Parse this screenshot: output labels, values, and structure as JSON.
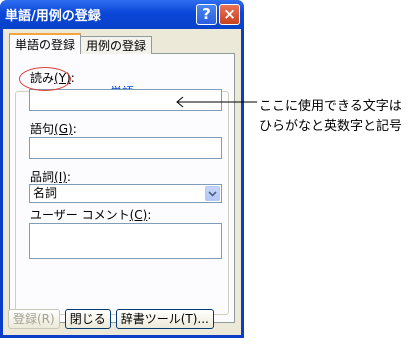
{
  "window": {
    "title": "単語/用例の登録",
    "help_glyph": "?",
    "close_glyph": "×"
  },
  "tabs": [
    {
      "label": "単語の登録",
      "active": true
    },
    {
      "label": "用例の登録",
      "active": false
    }
  ],
  "group": {
    "legend": "単語"
  },
  "fields": {
    "reading_label": "読み",
    "reading_accel": "(Y)",
    "reading_colon": ":",
    "reading_value": "",
    "phrase_label": "語句",
    "phrase_accel": "(G)",
    "phrase_colon": ":",
    "phrase_value": "",
    "pos_label": "品詞",
    "pos_accel": "(I)",
    "pos_colon": ":",
    "pos_value": "名詞",
    "comment_label": "ユーザー コメント",
    "comment_accel": "(C)",
    "comment_colon": ":",
    "comment_value": ""
  },
  "buttons": {
    "register": "登録(R)",
    "close": "閉じる",
    "dictionary_tool": "辞書ツール(T)..."
  },
  "annotation": {
    "line1": "ここに使用できる文字は",
    "line2": "ひらがなと英数字と記号"
  },
  "colors": {
    "titlebar": "#0a46d8",
    "annotation_ring": "#d8433a",
    "group_legend": "#0046d5"
  }
}
